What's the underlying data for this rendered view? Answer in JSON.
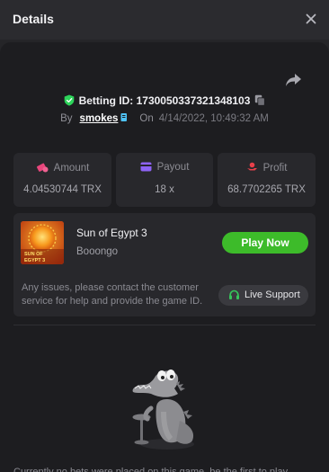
{
  "header": {
    "title": "Details",
    "close_icon": "close-icon"
  },
  "bet": {
    "id_label": "Betting ID:",
    "id_value": "1730050337321348103",
    "by_label": "By",
    "username": "smokes",
    "on_label": "On",
    "datetime": "4/14/2022, 10:49:32 AM"
  },
  "stats": [
    {
      "label": "Amount",
      "value": "4.04530744 TRX",
      "icon": "amount-icon",
      "color": "#e8467c"
    },
    {
      "label": "Payout",
      "value": "18 x",
      "icon": "payout-icon",
      "color": "#8e63f5"
    },
    {
      "label": "Profit",
      "value": "68.7702265 TRX",
      "icon": "profit-icon",
      "color": "#e8404a"
    }
  ],
  "game": {
    "name": "Sun of Egypt 3",
    "provider": "Booongo",
    "thumb_text_1": "SUN OF",
    "thumb_text_2": "EGYPT 3",
    "play_label": "Play Now",
    "issue_text": "Any issues, please contact the customer service for help and provide the game ID.",
    "support_label": "Live Support"
  },
  "colors": {
    "accent_green": "#3dbb2a",
    "verified_green": "#2dd45a",
    "background": "#1d1d20"
  },
  "footer": {
    "partial_text": "Currently no bets were placed on this game, be the first to play"
  }
}
